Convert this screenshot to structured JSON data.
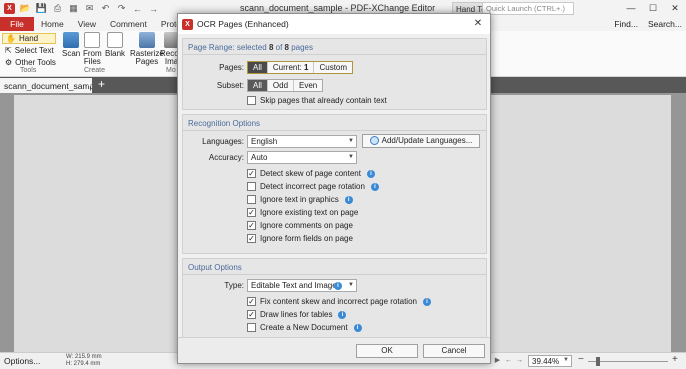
{
  "app": {
    "title": "scann_document_sample - PDF-XChange Editor",
    "hand_tool_tab": "Hand Too",
    "quick_launch_placeholder": "Quick Launch (CTRL+.)",
    "window_controls": {
      "minimize": "—",
      "maximize": "☐",
      "close": "✕"
    },
    "logo_letter": "X"
  },
  "menu": {
    "file": "File",
    "items": [
      "Home",
      "View",
      "Comment",
      "Protect",
      "Fo"
    ],
    "find": "Find...",
    "search": "Search..."
  },
  "ribbon": {
    "hand": "Hand",
    "select_text": "Select Text",
    "other_tools": "Other Tools",
    "tools_group": "Tools",
    "scan": "Scan",
    "from_files": "From",
    "from_files_2": "Files",
    "blank": "Blank",
    "create_group": "Create",
    "rasterize": "Rasterize",
    "rasterize_2": "Pages",
    "recognize": "Recon",
    "recognize_2": "Ima",
    "mo_group": "Mo"
  },
  "tabs": {
    "doc": "scann_document_sample",
    "close": "×",
    "add": "+"
  },
  "status": {
    "options": "Options...",
    "width": "W: 215.9 mm",
    "height": "H: 279.4 mm",
    "zoom": "39.44%"
  },
  "dialog": {
    "title": "OCR Pages (Enhanced)",
    "close": "✕",
    "page_range": {
      "header_prefix": "Page Range: selected ",
      "selected": "8",
      "header_mid": " of ",
      "total": "8",
      "header_suffix": " pages",
      "pages_label": "Pages:",
      "pages_options": {
        "all": "All",
        "current_label": "Current: ",
        "current_value": "1",
        "custom": "Custom"
      },
      "subset_label": "Subset:",
      "subset_options": {
        "all": "All",
        "odd": "Odd",
        "even": "Even"
      },
      "skip_text": "Skip pages that already contain text"
    },
    "recognition": {
      "header": "Recognition Options",
      "languages_label": "Languages:",
      "language_value": "English",
      "add_languages": "Add/Update Languages...",
      "accuracy_label": "Accuracy:",
      "accuracy_value": "Auto",
      "options": [
        {
          "label": "Detect skew of page content",
          "checked": true,
          "info": true
        },
        {
          "label": "Detect incorrect page rotation",
          "checked": false,
          "info": true
        },
        {
          "label": "Ignore text in graphics",
          "checked": false,
          "info": true
        },
        {
          "label": "Ignore existing text on page",
          "checked": true,
          "info": false
        },
        {
          "label": "Ignore comments on page",
          "checked": true,
          "info": false
        },
        {
          "label": "Ignore form fields on page",
          "checked": true,
          "info": false
        }
      ]
    },
    "output": {
      "header": "Output Options",
      "type_label": "Type:",
      "type_value": "Editable Text and Images",
      "options": [
        {
          "label": "Fix content skew and incorrect page rotation",
          "checked": true,
          "info": true
        },
        {
          "label": "Draw lines for tables",
          "checked": true,
          "info": true
        },
        {
          "label": "Create a New Document",
          "checked": false,
          "info": true
        }
      ]
    },
    "ok": "OK",
    "cancel": "Cancel",
    "info_glyph": "i",
    "check_glyph": "✓"
  }
}
